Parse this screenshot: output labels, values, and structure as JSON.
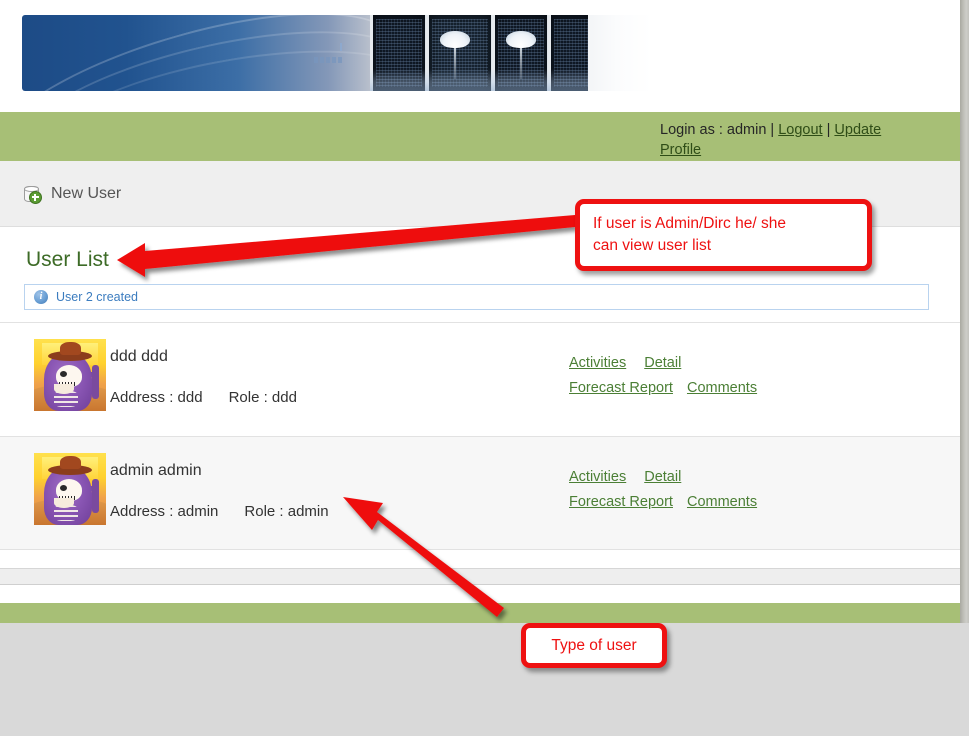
{
  "header": {
    "banner_alt": "data-center-banner"
  },
  "loginbar": {
    "prefix": "Login as : admin",
    "separator_1": " | ",
    "logout_label": "Logout",
    "separator_2": " | ",
    "update_profile_label": "Update Profile"
  },
  "toolbar": {
    "new_user_label": "New User",
    "new_user_icon": "database-add-icon"
  },
  "main": {
    "page_title": "User List",
    "info_message": "User 2 created",
    "info_icon": "info-circle-icon",
    "labels": {
      "address": "Address",
      "role": "Role",
      "colon": " : "
    },
    "users": [
      {
        "name": "ddd ddd",
        "address_label": "Address : ddd",
        "role_label": "Role : ddd",
        "avatar": "skeleton-cowboy-avatar",
        "links": [
          "Activities",
          "Detail",
          "Forecast Report",
          "Comments"
        ]
      },
      {
        "name": "admin admin",
        "address_label": "Address : admin",
        "role_label": "Role : admin",
        "avatar": "skeleton-cowboy-avatar",
        "links": [
          "Activities",
          "Detail",
          "Forecast Report",
          "Comments"
        ]
      }
    ]
  },
  "annotations": [
    {
      "id": "callout-admin-view",
      "line1": "If user is Admin/Dirc  he/ she",
      "line2": "can view user list",
      "color": "#ee1111"
    },
    {
      "id": "callout-type-of-user",
      "text": "Type of user",
      "color": "#ee1111"
    }
  ],
  "colors": {
    "green_band": "#a7bf76",
    "link_green": "#4b7f35",
    "title_green": "#3d6b27",
    "info_blue": "#3b7cbf",
    "annotation_red": "#ee1111",
    "page_bg": "#ffffff",
    "desktop_bg": "#d9d9d9"
  }
}
